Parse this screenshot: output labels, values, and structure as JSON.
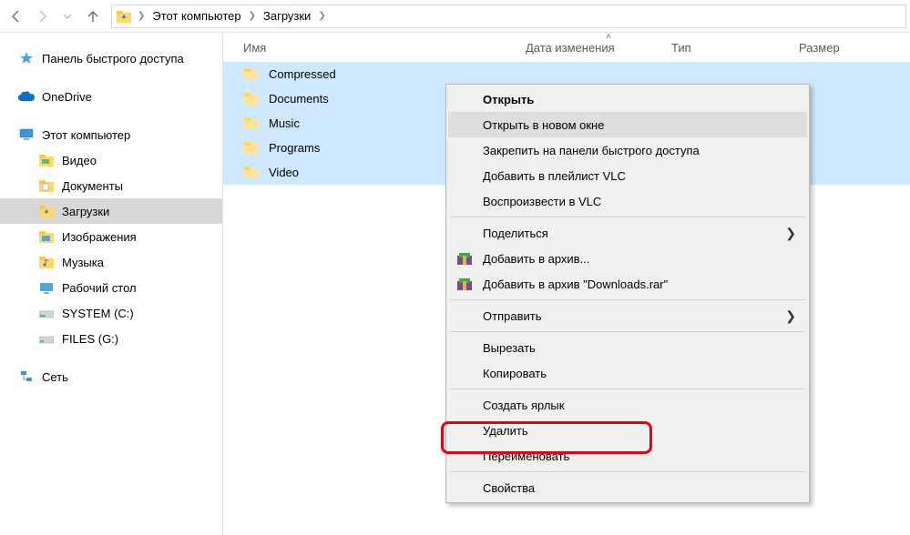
{
  "breadcrumb": {
    "root": "Этот компьютер",
    "folder": "Загрузки"
  },
  "columns": {
    "name": "Имя",
    "date": "Дата изменения",
    "type": "Тип",
    "size": "Размер"
  },
  "sidebar": {
    "quick": "Панель быстрого доступа",
    "onedrive": "OneDrive",
    "thispc": "Этот компьютер",
    "video": "Видео",
    "documents": "Документы",
    "downloads": "Загрузки",
    "pictures": "Изображения",
    "music": "Музыка",
    "desktop": "Рабочий стол",
    "drive_c": "SYSTEM (C:)",
    "drive_g": "FILES (G:)",
    "network": "Сеть"
  },
  "files": {
    "f0": "Compressed",
    "f1": "Documents",
    "f2": "Music",
    "f3": "Programs",
    "f4": "Video"
  },
  "context_menu": {
    "open": "Открыть",
    "open_new": "Открыть в новом окне",
    "pin_quick": "Закрепить на панели быстрого доступа",
    "vlc_add": "Добавить в плейлист VLC",
    "vlc_play": "Воспроизвести в VLC",
    "share": "Поделиться",
    "rar_add": "Добавить в архив...",
    "rar_add_named": "Добавить в архив \"Downloads.rar\"",
    "send": "Отправить",
    "cut": "Вырезать",
    "copy": "Копировать",
    "shortcut": "Создать ярлык",
    "delete": "Удалить",
    "rename": "Переименовать",
    "properties": "Свойства"
  }
}
